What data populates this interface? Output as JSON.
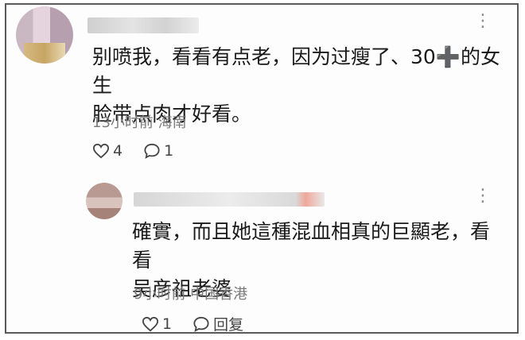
{
  "comments": [
    {
      "text_line1": "别喷我，看看有点老，因为过瘦了、30➕的女生",
      "text_line2": "脸带点肉才好看。",
      "meta": "13小时前 海南",
      "likes": "4",
      "replies": "1"
    },
    {
      "text_line1": "確實，而且她這種混血相真的巨顯老，看看",
      "text_line2": "吴彦祖老婆",
      "meta": "9小时前 中国香港",
      "likes": "1",
      "reply_label": "回复"
    }
  ],
  "more_glyph": "⋮"
}
